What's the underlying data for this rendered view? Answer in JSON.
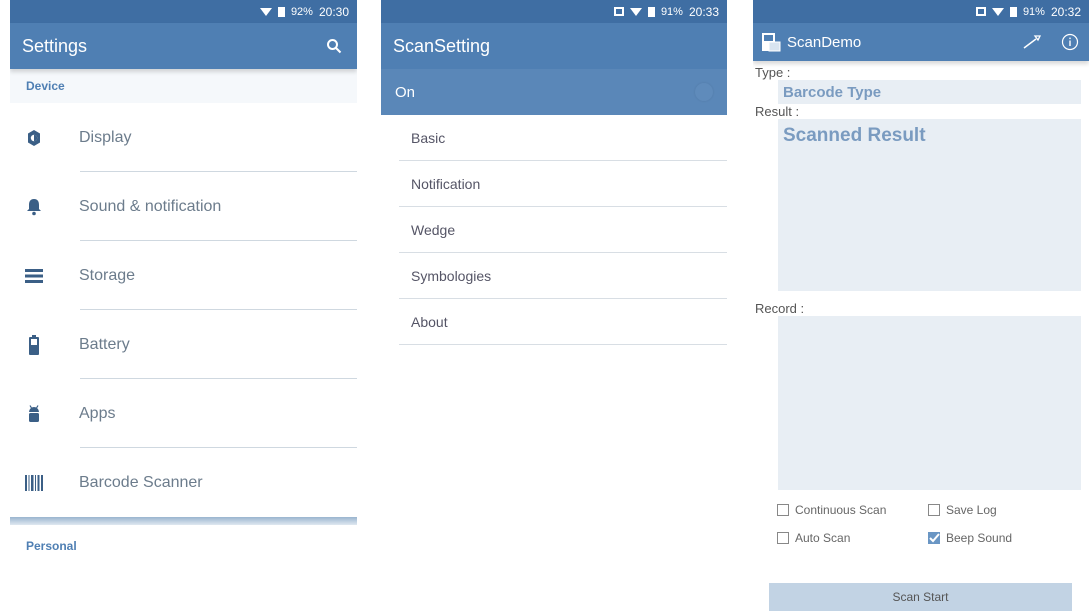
{
  "settings": {
    "status": {
      "battery": "92%",
      "time": "20:30"
    },
    "title": "Settings",
    "section_device": "Device",
    "items": [
      {
        "label": "Display",
        "icon": "brightness-icon"
      },
      {
        "label": "Sound & notification",
        "icon": "bell-icon"
      },
      {
        "label": "Storage",
        "icon": "storage-icon"
      },
      {
        "label": "Battery",
        "icon": "battery-icon"
      },
      {
        "label": "Apps",
        "icon": "android-icon"
      },
      {
        "label": "Barcode Scanner",
        "icon": "barcode-icon"
      }
    ],
    "section_personal": "Personal"
  },
  "scansetting": {
    "status": {
      "battery": "91%",
      "time": "20:33"
    },
    "title": "ScanSetting",
    "on_label": "On",
    "menu": [
      "Basic",
      "Notification",
      "Wedge",
      "Symbologies",
      "About"
    ]
  },
  "scandemo": {
    "status": {
      "battery": "91%",
      "time": "20:32"
    },
    "title": "ScanDemo",
    "type_label": "Type :",
    "type_value": "Barcode Type",
    "result_label": "Result :",
    "result_value": "Scanned Result",
    "record_label": "Record :",
    "options": {
      "continuous": "Continuous Scan",
      "save_log": "Save Log",
      "auto_scan": "Auto Scan",
      "beep": "Beep Sound"
    },
    "beep_checked": true,
    "scan_button": "Scan Start"
  },
  "colors": {
    "appbar": "#4f7fb3",
    "statusbar": "#3f6ea3",
    "accent": "#6a96c4"
  }
}
